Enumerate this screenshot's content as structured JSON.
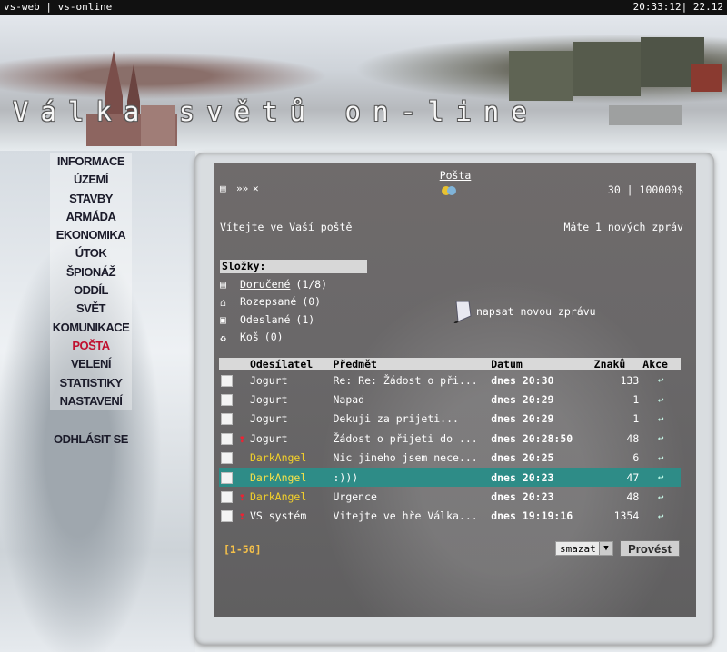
{
  "topbar": {
    "left_text": "vs-web | vs-online",
    "clock": "20:33:12| 22.12"
  },
  "header": {
    "title": "Válka světů on-line"
  },
  "nav": {
    "items": [
      "INFORMACE",
      "ÚZEMÍ",
      "STAVBY",
      "ARMÁDA",
      "EKONOMIKA",
      "ÚTOK",
      "ŠPIONÁŽ",
      "ODDÍL",
      "SVĚT",
      "KOMUNIKACE",
      "POŠTA",
      "VELENÍ",
      "STATISTIKY",
      "NASTAVENÍ"
    ],
    "active": "POŠTA",
    "logout": "ODHLÁSIT SE"
  },
  "mail": {
    "title": "Pošta",
    "money": "30 | 100000$",
    "welcome": "Vítejte ve Vaší poště",
    "new_messages": "Máte 1 nových zpráv",
    "folders_header": "Složky:",
    "folders": [
      {
        "label": "Doručené",
        "count": "(1/8)",
        "icon": "inbox-icon"
      },
      {
        "label": "Rozepsané",
        "count": "(0)",
        "icon": "drafts-icon"
      },
      {
        "label": "Odeslané",
        "count": "(1)",
        "icon": "sent-icon"
      },
      {
        "label": "Koš",
        "count": "(0)",
        "icon": "trash-icon"
      }
    ],
    "compose": "napsat novou zprávu",
    "columns": {
      "sender": "Odesílatel",
      "subject": "Předmět",
      "date": "Datum",
      "chars": "Znaků",
      "action": "Akce"
    },
    "messages": [
      {
        "sender": "Jogurt",
        "subject": "Re: Re: Žádost o při...",
        "date": "dnes 20:30",
        "chars": "133",
        "flag": false,
        "gold": false
      },
      {
        "sender": "Jogurt",
        "subject": "Napad",
        "date": "dnes 20:29",
        "chars": "1",
        "flag": false,
        "gold": false
      },
      {
        "sender": "Jogurt",
        "subject": "Dekuji za prijeti...",
        "date": "dnes 20:29",
        "chars": "1",
        "flag": false,
        "gold": false
      },
      {
        "sender": "Jogurt",
        "subject": "Žádost o přijeti do ...",
        "date": "dnes 20:28:50",
        "chars": "48",
        "flag": true,
        "gold": false
      },
      {
        "sender": "DarkAngel",
        "subject": "Nic jineho jsem nece...",
        "date": "dnes 20:25",
        "chars": "6",
        "flag": false,
        "gold": true
      },
      {
        "sender": "DarkAngel",
        "subject": ":)))",
        "date": "dnes 20:23",
        "chars": "47",
        "flag": false,
        "gold": true,
        "selected": true
      },
      {
        "sender": "DarkAngel",
        "subject": "Urgence",
        "date": "dnes 20:23",
        "chars": "48",
        "flag": true,
        "gold": true
      },
      {
        "sender": "VS systém",
        "subject": "Vitejte ve hře Válka...",
        "date": "dnes 19:19:16",
        "chars": "1354",
        "flag": true,
        "gold": false
      }
    ],
    "pagination": "[1-50]",
    "action_select": "smazat",
    "submit": "Provést",
    "colors": {
      "selected_row": "#2e8c87",
      "gold_sender": "#f2d02a",
      "active_nav": "#c0102f"
    }
  }
}
